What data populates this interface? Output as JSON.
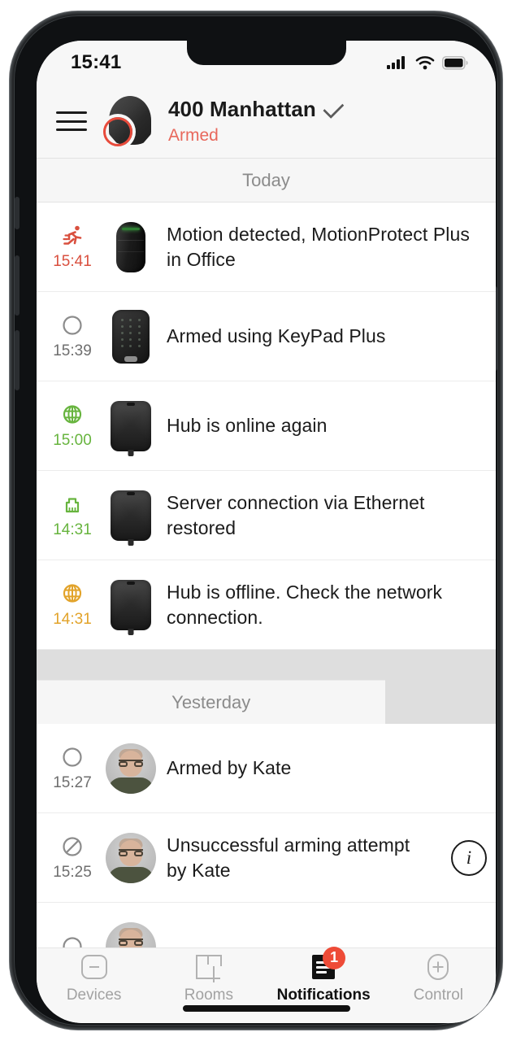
{
  "status_bar": {
    "time": "15:41",
    "signal_icon": "cellular-signal-icon",
    "wifi_icon": "wifi-icon",
    "battery_icon": "battery-full-icon"
  },
  "header": {
    "menu_icon": "hamburger-menu-icon",
    "avatar_icon": "hub-avatar-icon",
    "title": "400 Manhattan",
    "chevron_icon": "chevron-down-icon",
    "status": "Armed",
    "status_color": "#e8685c"
  },
  "groups": [
    {
      "label": "Today",
      "items": [
        {
          "time": "15:41",
          "time_color": "#d9503f",
          "icon": "running-person-icon",
          "thumb": "motion-detector-device",
          "text": "Motion detected, MotionProtect Plus in Office",
          "action": null
        },
        {
          "time": "15:39",
          "time_color": "#6e6e6e",
          "icon": "circle-icon",
          "thumb": "keypad-device",
          "text": "Armed using KeyPad Plus",
          "action": null
        },
        {
          "time": "15:00",
          "time_color": "#67b43e",
          "icon": "globe-icon",
          "thumb": "hub-device",
          "text": "Hub is online again",
          "action": null
        },
        {
          "time": "14:31",
          "time_color": "#67b43e",
          "icon": "ethernet-port-icon",
          "thumb": "hub-device",
          "text": "Server connection via Ethernet restored",
          "action": null
        },
        {
          "time": "14:31",
          "time_color": "#e2a32a",
          "icon": "globe-icon",
          "thumb": "hub-device",
          "text": "Hub is offline. Check the network connection.",
          "action": null
        }
      ]
    },
    {
      "label": "Yesterday",
      "items": [
        {
          "time": "15:27",
          "time_color": "#6e6e6e",
          "icon": "circle-icon",
          "thumb": "user-avatar-photo",
          "text": "Armed by Kate",
          "action": null
        },
        {
          "time": "15:25",
          "time_color": "#6e6e6e",
          "icon": "prohibited-icon",
          "thumb": "user-avatar-photo",
          "text": "Unsuccessful arming attempt by Kate",
          "action": "info-icon"
        }
      ]
    }
  ],
  "tabbar": {
    "tabs": [
      {
        "label": "Devices",
        "icon": "devices-icon",
        "active": false,
        "badge": null
      },
      {
        "label": "Rooms",
        "icon": "rooms-floorplan-icon",
        "active": false,
        "badge": null
      },
      {
        "label": "Notifications",
        "icon": "notifications-document-icon",
        "active": true,
        "badge": "1"
      },
      {
        "label": "Control",
        "icon": "control-plus-icon",
        "active": false,
        "badge": null
      }
    ],
    "badge_color": "#ee4b37"
  }
}
